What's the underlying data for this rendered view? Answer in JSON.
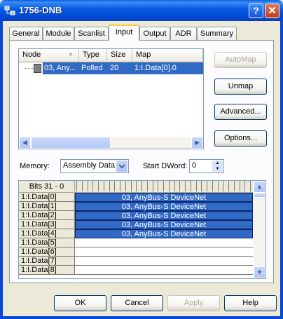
{
  "window": {
    "title": "1756-DNB",
    "help_glyph": "?",
    "close_glyph": "✕"
  },
  "tabs": [
    {
      "label": "General",
      "active": false
    },
    {
      "label": "Module",
      "active": false
    },
    {
      "label": "Scanlist",
      "active": false
    },
    {
      "label": "Input",
      "active": true
    },
    {
      "label": "Output",
      "active": false
    },
    {
      "label": "ADR",
      "active": false
    },
    {
      "label": "Summary",
      "active": false
    }
  ],
  "listview": {
    "columns": [
      "Node",
      "Type",
      "Size",
      "Map"
    ],
    "rows": [
      {
        "node": "03, Any...",
        "type": "Polled",
        "size": "20",
        "map": "1:I.Data[0].0",
        "selected": true
      }
    ]
  },
  "buttons": {
    "automap": "AutoMap",
    "unmap": "Unmap",
    "advanced": "Advanced...",
    "options": "Options...",
    "ok": "OK",
    "cancel": "Cancel",
    "apply": "Apply",
    "help": "Help"
  },
  "memory": {
    "label": "Memory:",
    "value": "Assembly Data"
  },
  "start_dword": {
    "label": "Start DWord:",
    "value": "0"
  },
  "grid": {
    "header": "Bits 31 - 0",
    "rows": [
      {
        "label": "1:I.Data[0]",
        "mapping": "03, AnyBus-S DeviceNet"
      },
      {
        "label": "1:I.Data[1]",
        "mapping": "03, AnyBus-S DeviceNet"
      },
      {
        "label": "1:I.Data[2]",
        "mapping": "03, AnyBus-S DeviceNet"
      },
      {
        "label": "1:I.Data[3]",
        "mapping": "03, AnyBus-S DeviceNet"
      },
      {
        "label": "1:I.Data[4]",
        "mapping": "03, AnyBus-S DeviceNet"
      },
      {
        "label": "1:I.Data[5]",
        "mapping": ""
      },
      {
        "label": "1:I.Data[6]",
        "mapping": ""
      },
      {
        "label": "1:I.Data[7]",
        "mapping": ""
      },
      {
        "label": "1:I.Data[8]",
        "mapping": ""
      }
    ]
  },
  "colors": {
    "selection": "#316AC5",
    "titlebar": "#0558E0",
    "tab_highlight": "#FFC83C"
  }
}
